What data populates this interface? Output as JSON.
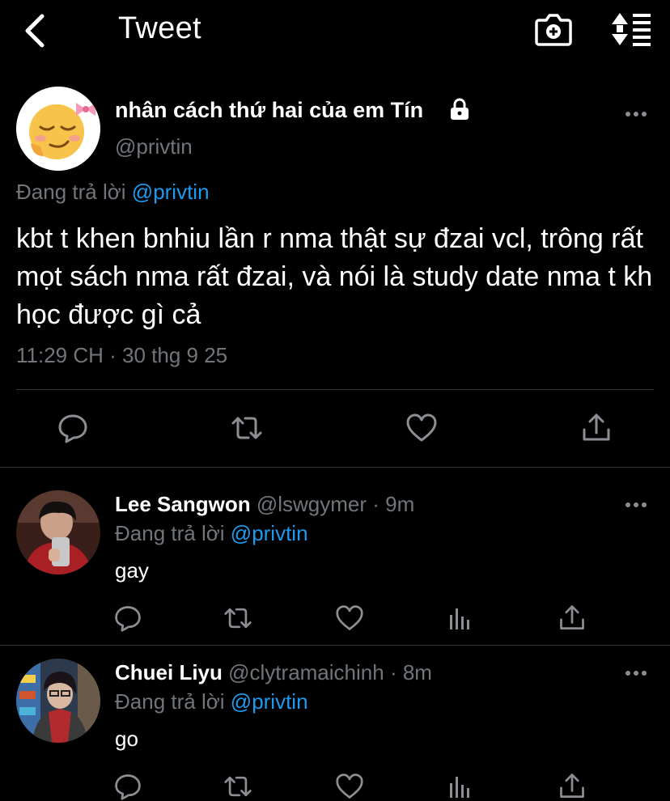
{
  "header": {
    "title": "Tweet",
    "icons": [
      "back-arrow-icon",
      "camera-plus-icon",
      "sort-toggle-icon"
    ]
  },
  "main_tweet": {
    "display_name": "nhân cách thứ hai của em Tín",
    "handle": "@privtin",
    "replying_prefix": "Đang trả lời",
    "replying_to": "@privtin",
    "text": "kbt t khen bnhiu lần r nma thật sự đzai vcl, trông rất mọt sách nma rất đzai, và nói là study date nma t kh học được gì cả",
    "timestamp": "11:29 CH · 30 thg 9 25",
    "protected": true
  },
  "replies": [
    {
      "display_name": "Lee Sangwon",
      "handle": "@lswgymer",
      "separator": "·",
      "time": "9m",
      "replying_prefix": "Đang trả lời",
      "replying_to": "@privtin",
      "text": "gay"
    },
    {
      "display_name": "Chuei Liyu",
      "handle": "@clytramaichinh",
      "separator": "·",
      "time": "8m",
      "replying_prefix": "Đang trả lời",
      "replying_to": "@privtin",
      "text": "go"
    }
  ],
  "colors": {
    "background": "#000000",
    "text_primary": "#ffffff",
    "text_secondary": "#71767b",
    "accent": "#1d9bf0",
    "divider": "#2f3336"
  }
}
